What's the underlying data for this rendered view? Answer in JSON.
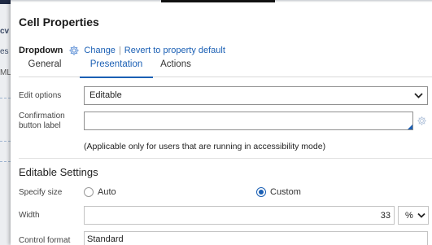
{
  "background": {
    "fragments": [
      "cv",
      "es",
      "ML"
    ]
  },
  "dialog": {
    "title": "Cell Properties",
    "control_type": "Dropdown",
    "change_link": "Change",
    "separator": "|",
    "revert_link": "Revert to property default",
    "tabs": [
      {
        "label": "General",
        "active": false
      },
      {
        "label": "Presentation",
        "active": true
      },
      {
        "label": "Actions",
        "active": false
      }
    ]
  },
  "presentation": {
    "edit_options_label": "Edit options",
    "edit_options_value": "Editable",
    "confirmation_label_line1": "Confirmation",
    "confirmation_label_line2": "button label",
    "confirmation_value": "",
    "accessibility_hint": "(Applicable only for users that are running in accessibility mode)"
  },
  "editable_settings": {
    "section_title": "Editable Settings",
    "specify_size_label": "Specify size",
    "size_options": [
      {
        "label": "Auto",
        "checked": false
      },
      {
        "label": "Custom",
        "checked": true
      }
    ],
    "width_label": "Width",
    "width_value": "33",
    "width_unit": "%",
    "control_format_label": "Control format",
    "control_format_value": "Standard"
  },
  "colors": {
    "accent": "#1a5fb4",
    "text": "#333333"
  }
}
